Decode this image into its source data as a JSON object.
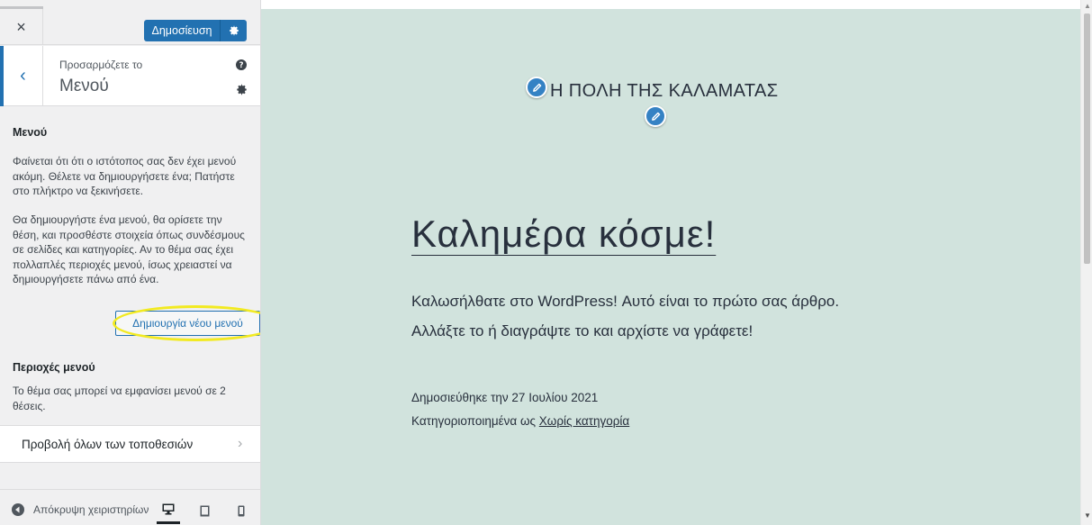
{
  "sidebar": {
    "close_icon": "×",
    "publish_label": "Δημοσίευση",
    "customizing_label": "Προσαρμόζετε το",
    "section_title": "Μενού",
    "menus_heading": "Μενού",
    "intro_paragraph_1": "Φαίνεται ότι ότι ο ιστότοπος σας δεν έχει μενού ακόμη. Θέλετε να δημιουργήσετε ένα; Πατήστε στο πλήκτρο να ξεκινήσετε.",
    "intro_paragraph_2": "Θα δημιουργήστε ένα μενού, θα ορίσετε την θέση, και προσθέστε στοιχεία όπως συνδέσμους σε σελίδες και κατηγορίες. Αν το θέμα σας έχει πολλαπλές περιοχές μενού, ίσως χρειαστεί να δημιουργήσετε πάνω από ένα.",
    "create_menu_button": "Δημιουργία νέου μενού",
    "locations_heading": "Περιοχές μενού",
    "locations_description": "Το θέμα σας μπορεί να εμφανίσει μενού σε 2 θέσεις.",
    "view_all_locations": "Προβολή όλων των τοποθεσιών",
    "collapse_label": "Απόκρυψη χειριστηρίων",
    "highlight_color": "#f2ea21",
    "accent_color": "#2271b1"
  },
  "preview": {
    "site_title": "Η ΠΟΛΗ ΤΗΣ ΚΑΛΑΜΑΤΑΣ",
    "post_title": "Καλημέρα κόσμε!",
    "post_body_line_1": "Καλωσήλθατε στο WordPress! Αυτό είναι το πρώτο σας άρθρο.",
    "post_body_line_2": "Αλλάξτε το ή διαγράψτε το και αρχίστε να γράφετε!",
    "meta_published": "Δημοσιεύθηκε την 27 Ιουλίου 2021",
    "meta_category_prefix": "Κατηγοριοποιημένα ως ",
    "meta_category_link": "Χωρίς κατηγορία",
    "background_color": "#d1e3dd"
  }
}
